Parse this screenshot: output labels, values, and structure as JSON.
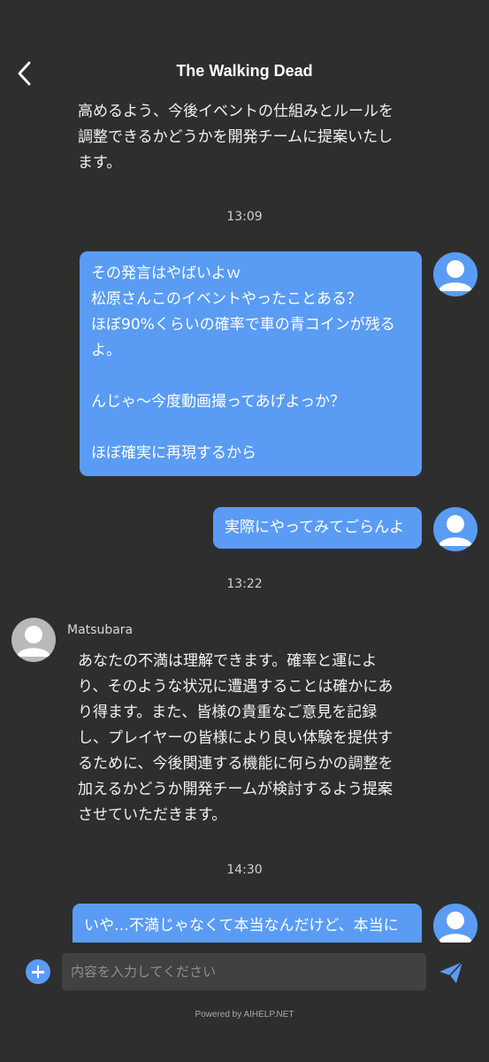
{
  "header": {
    "title": "The Walking Dead"
  },
  "messages": {
    "agent_partial": "高めるよう、今後イベントの仕組みとルールを\n調整できるかどうかを開発チームに提案いたし\nます。",
    "time1": "13:09",
    "user1": "その発言はやばいよｗ\n松原さんこのイベントやったことある？\nほぼ90%くらいの確率で車の青コインが残る\nよ。\n\nんじゃ〜今度動画撮ってあげよっか？\n\nほぼ確実に再現するから",
    "user2": "実際にやってみてごらんよ",
    "time2": "13:22",
    "agent_name": "Matsubara",
    "agent_msg": "あなたの不満は理解できます。確率と運によ\nり、そのような状況に遭遇することは確かにあ\nり得ます。また、皆様の貴重なご意見を記録\nし、プレイヤーの皆様により良い体験を提供す\nるために、今後関連する機能に何らかの調整を\n加えるかどうか開発チームが検討するよう提案\nさせていただきます。",
    "time3": "14:30",
    "user3": "いや…不満じゃなくて本当なんだけど、本当に"
  },
  "input": {
    "placeholder": "内容を入力してください"
  },
  "footer": {
    "powered": "Powered by AIHELP.NET"
  },
  "icons": {
    "back": "chevron-left-icon",
    "add": "plus-icon",
    "send": "send-icon",
    "avatar": "person-avatar-icon"
  },
  "colors": {
    "background": "#2f2e2f",
    "bubble": "#5a9cf4",
    "user_avatar": "#5a9cf4",
    "agent_avatar": "#b9b9b9",
    "send_icon": "#5a9cf4"
  }
}
